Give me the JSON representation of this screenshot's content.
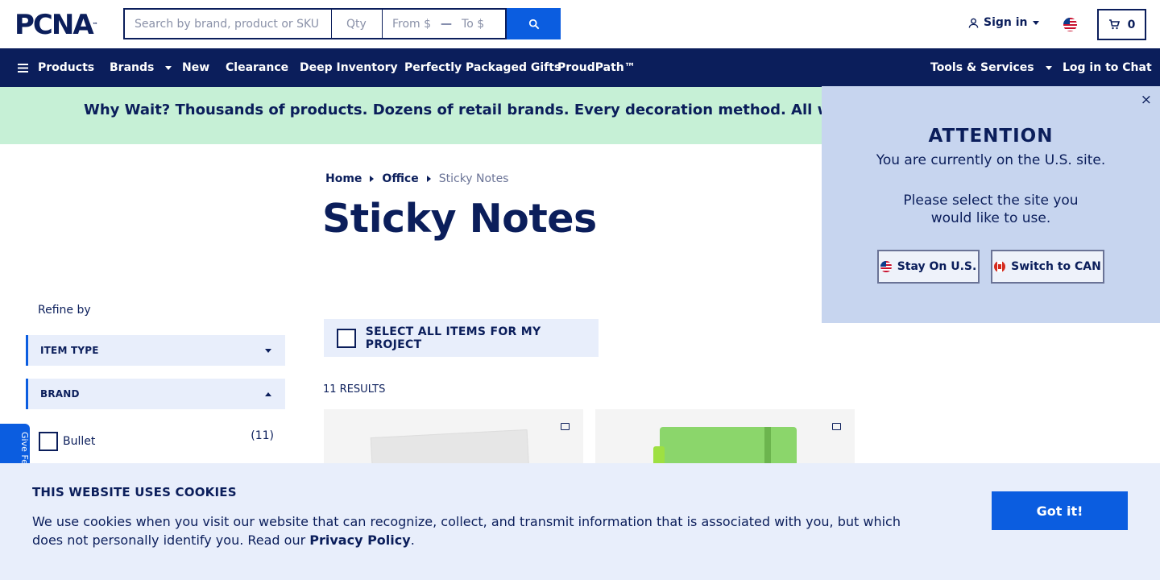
{
  "header": {
    "logo_text": "PCNA",
    "logo_tm": "™",
    "search_placeholder": "Search by brand, product or SKU",
    "qty_placeholder": "Qty",
    "price_from_placeholder": "From $",
    "price_dash": "—",
    "price_to_placeholder": "To $",
    "signin_label": "Sign in",
    "cart_count": "0"
  },
  "nav": {
    "products": "Products",
    "brands": "Brands",
    "new": "New",
    "clearance": "Clearance",
    "deep_inventory": "Deep Inventory",
    "gifts": "Perfectly Packaged Gifts",
    "proudpath": "ProudPath™",
    "tools": "Tools & Services",
    "chat": "Log in to Chat"
  },
  "promo": {
    "text": "Why Wait? Thousands of products. Dozens of retail brands. Every decoration method. All with a standard"
  },
  "breadcrumb": {
    "home": "Home",
    "office": "Office",
    "current": "Sticky Notes"
  },
  "page": {
    "title": "Sticky Notes"
  },
  "sidebar": {
    "refine_label": "Refine by",
    "facets": [
      {
        "label": "ITEM TYPE",
        "expanded": false
      },
      {
        "label": "BRAND",
        "expanded": true
      }
    ],
    "brand_options": [
      {
        "label": "Bullet",
        "count": "(11)"
      }
    ],
    "feedback_label": "Give Fe"
  },
  "results": {
    "select_all_label": "SELECT ALL ITEMS FOR MY PROJECT",
    "count_label": "11 RESULTS"
  },
  "attention": {
    "title": "ATTENTION",
    "line1": "You are currently on the U.S. site.",
    "line2": "Please select the site you",
    "line3": "would like to use.",
    "stay_label": "Stay On U.S.",
    "switch_label": "Switch to CAN",
    "close_glyph": "×"
  },
  "cookie": {
    "title": "THIS WEBSITE USES COOKIES",
    "text": "We use cookies when you visit our website that can recognize, collect, and transmit information that is associated with you, but which does not personally identify you. Read our ",
    "privacy_link": "Privacy Policy",
    "period": ".",
    "accept_label": "Got it!"
  },
  "colors": {
    "brand_navy": "#0b1e5b",
    "accent_blue": "#0b5de0",
    "promo_green": "#c6f0d6",
    "popup_bg": "#c7d5ef",
    "cookie_bg": "#e8eefb"
  }
}
